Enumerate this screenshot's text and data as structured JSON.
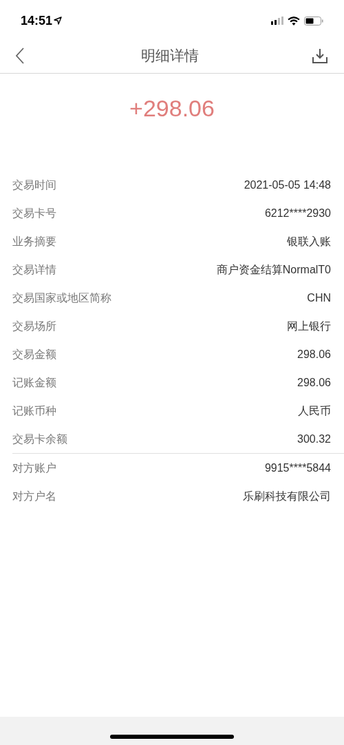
{
  "status_bar": {
    "time": "14:51"
  },
  "nav": {
    "title": "明细详情"
  },
  "amount": "+298.06",
  "groups": [
    {
      "rows": [
        {
          "label": "交易时间",
          "value": "2021-05-05 14:48"
        },
        {
          "label": "交易卡号",
          "value": "6212****2930"
        },
        {
          "label": "业务摘要",
          "value": "银联入账"
        },
        {
          "label": "交易详情",
          "value": "商户资金结算NormalT0"
        },
        {
          "label": "交易国家或地区简称",
          "value": "CHN"
        },
        {
          "label": "交易场所",
          "value": "网上银行"
        },
        {
          "label": "交易金额",
          "value": "298.06"
        },
        {
          "label": "记账金额",
          "value": "298.06"
        },
        {
          "label": "记账币种",
          "value": "人民币"
        },
        {
          "label": "交易卡余额",
          "value": "300.32"
        }
      ]
    },
    {
      "rows": [
        {
          "label": "对方账户",
          "value": "9915****5844"
        },
        {
          "label": "对方户名",
          "value": "乐刷科技有限公司"
        }
      ]
    }
  ]
}
